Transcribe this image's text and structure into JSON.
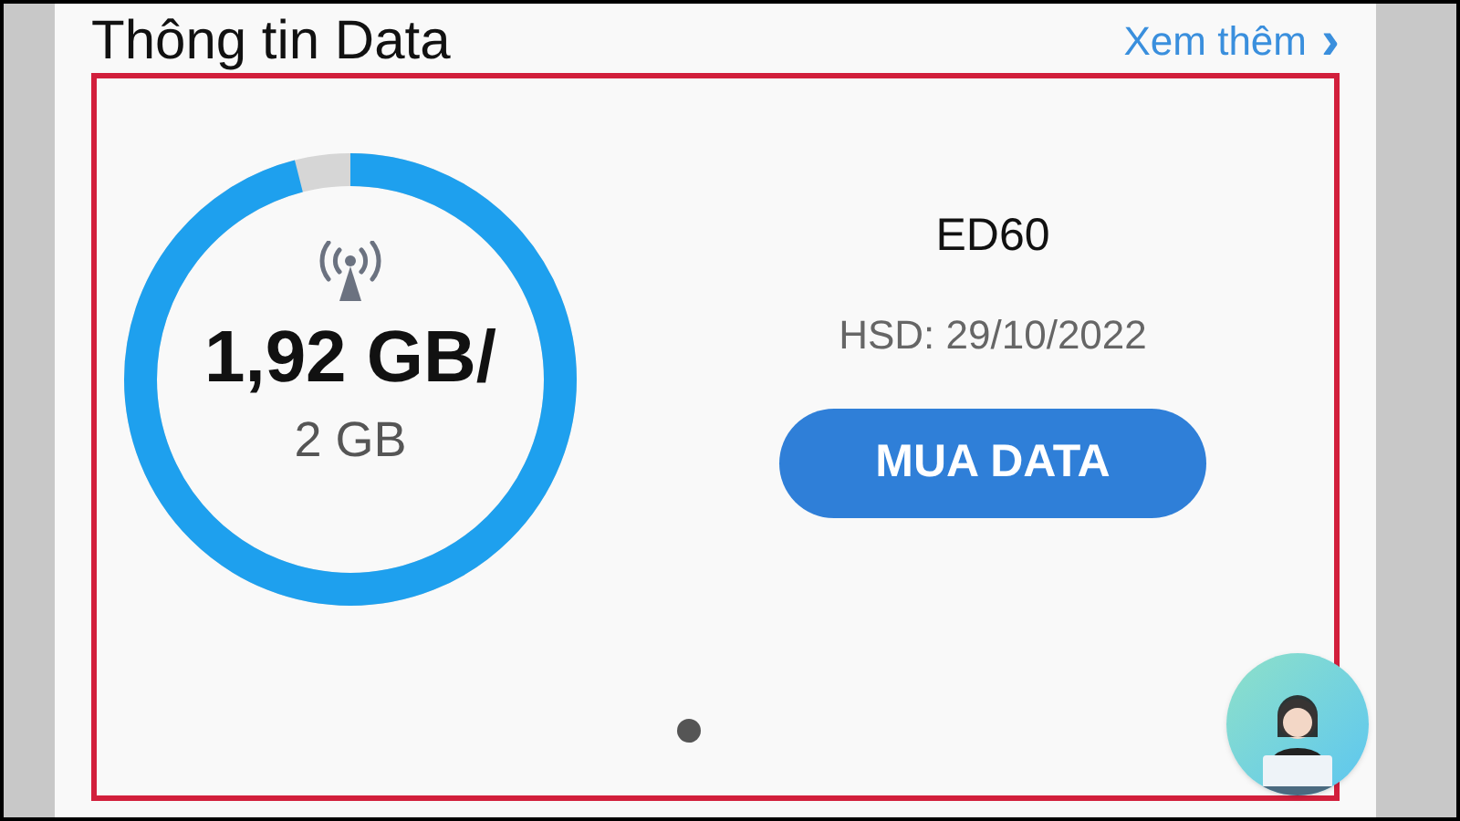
{
  "header": {
    "title": "Thông tin Data",
    "more_link": "Xem thêm",
    "more_icon": "›"
  },
  "usage": {
    "used": "1,92 GB/",
    "total": "2 GB",
    "level": 0.96
  },
  "plan": {
    "name": "ED60",
    "expiry": "HSD: 29/10/2022"
  },
  "buy_button": "MUA DATA",
  "page_dots": [
    {
      "selected": true
    }
  ]
}
